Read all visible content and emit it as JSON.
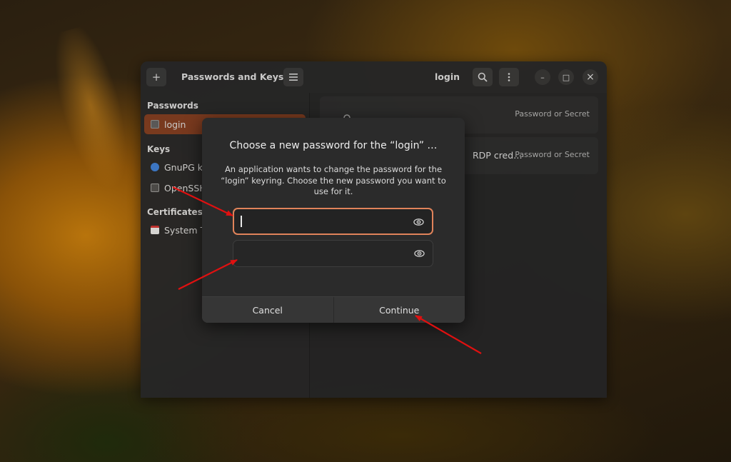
{
  "window": {
    "title": "Passwords and Keys",
    "content_title": "login",
    "add_icon": "plus-icon",
    "menu_icon": "hamburger-icon",
    "search_icon": "search-icon",
    "more_icon": "vertical-dots-icon",
    "controls": {
      "minimize": "–",
      "maximize": "□",
      "close": "×"
    }
  },
  "sidebar": {
    "passwords_heading": "Passwords",
    "keys_heading": "Keys",
    "certificates_heading": "Certificates",
    "items": [
      {
        "label": "login",
        "icon": "keyring-icon",
        "selected": true
      },
      {
        "label": "GnuPG ke",
        "icon": "gnupg-key-icon"
      },
      {
        "label": "OpenSSH",
        "icon": "ssh-key-icon"
      },
      {
        "label": "System T",
        "icon": "certificate-icon"
      }
    ]
  },
  "main": {
    "rows": [
      {
        "name": "",
        "subtitle": "Password or Secret"
      },
      {
        "name": "RDP cred…",
        "subtitle": "Password or Secret"
      }
    ]
  },
  "dialog": {
    "title": "Choose a new password for the “login” …",
    "body": "An application wants to change the password for the “login” keyring. Choose the new password you want to use for it.",
    "password_value": "",
    "confirm_value": "",
    "cancel_label": "Cancel",
    "continue_label": "Continue"
  },
  "colors": {
    "accent": "#e0835a",
    "selected_sidebar": "#7a3a1f",
    "annotation_arrow": "#e01010"
  }
}
